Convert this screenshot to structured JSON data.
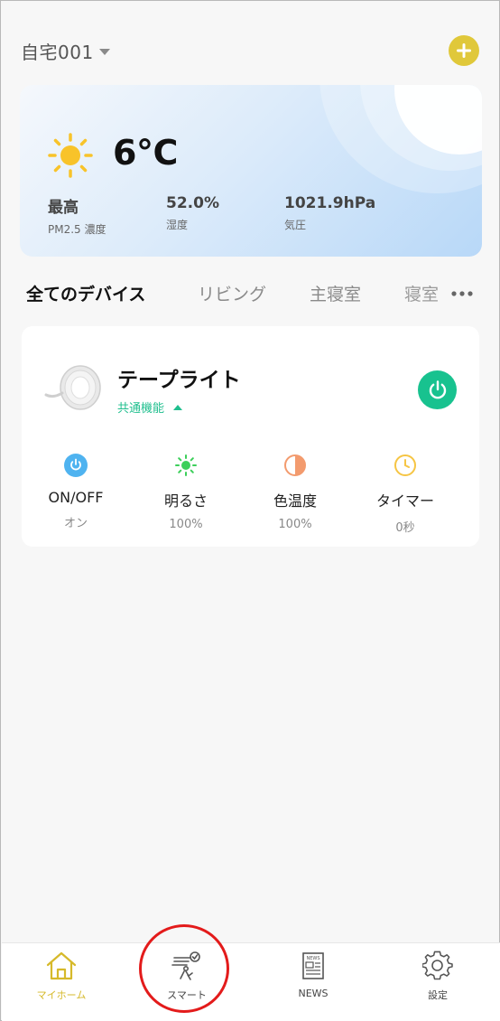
{
  "header": {
    "home_name": "自宅001"
  },
  "weather": {
    "temperature": "6°C",
    "stats": [
      {
        "value": "最高",
        "label": "PM2.5 濃度"
      },
      {
        "value": "52.0%",
        "label": "湿度"
      },
      {
        "value": "1021.9hPa",
        "label": "気圧"
      }
    ]
  },
  "tabs": [
    {
      "label": "全てのデバイス",
      "active": true
    },
    {
      "label": "リビング"
    },
    {
      "label": "主寝室"
    },
    {
      "label": "寝室"
    }
  ],
  "device": {
    "name": "テープライト",
    "function_label": "共通機能",
    "controls": [
      {
        "name": "ON/OFF",
        "value": "オン",
        "icon": "power-icon"
      },
      {
        "name": "明るさ",
        "value": "100%",
        "icon": "brightness-icon"
      },
      {
        "name": "色温度",
        "value": "100%",
        "icon": "color-temperature-icon"
      },
      {
        "name": "タイマー",
        "value": "0秒",
        "icon": "timer-icon"
      }
    ]
  },
  "nav": [
    {
      "label": "マイホーム",
      "icon": "home-icon",
      "active": true
    },
    {
      "label": "スマート",
      "icon": "smart-scene-icon"
    },
    {
      "label": "NEWS",
      "icon": "news-icon"
    },
    {
      "label": "設定",
      "icon": "gear-icon"
    }
  ],
  "colors": {
    "accent": "#e0c83a",
    "green": "#18c28f",
    "highlight": "#e31b1b"
  }
}
